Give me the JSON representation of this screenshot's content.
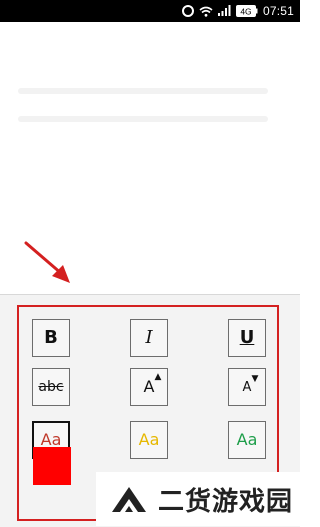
{
  "status_bar": {
    "time": "07:51",
    "battery": "4G",
    "icons": [
      "alarm-icon",
      "wifi-icon",
      "signal-icon",
      "battery-icon"
    ]
  },
  "toolbar": {
    "bold_label": "B",
    "italic_label": "I",
    "underline_label": "U",
    "strike_label": "abc",
    "grow_label": "A",
    "shrink_label": "A",
    "color_red_label": "Aa",
    "color_yellow_label": "Aa",
    "color_green_label": "Aa"
  },
  "colors": {
    "frame": "#d42020",
    "text_red": "#c0392b",
    "text_yellow": "#e6b800",
    "text_green": "#1e9e4a",
    "swatch_red": "#ff0000",
    "swatch_yellow": "#f2e600",
    "swatch_green": "#33cc33",
    "arrow": "#d42020"
  },
  "watermark": {
    "text": "二货游戏园"
  }
}
